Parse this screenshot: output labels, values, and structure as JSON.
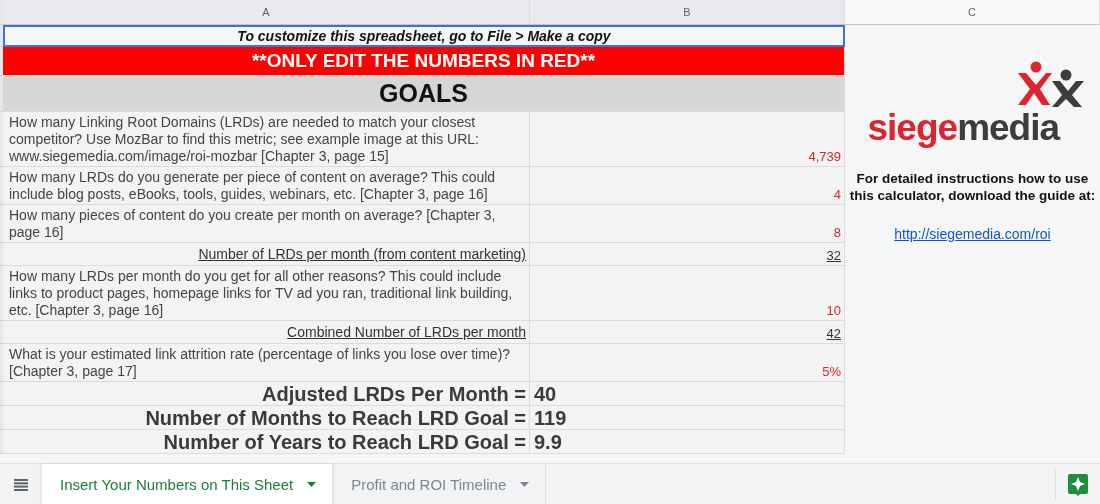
{
  "columns": [
    {
      "label": "A",
      "selected": true
    },
    {
      "label": "B",
      "selected": true
    },
    {
      "label": "C",
      "selected": false
    }
  ],
  "banner": {
    "text": "To customize this spreadsheet, go to File > Make a copy",
    "selected": true
  },
  "warning": "**ONLY EDIT THE NUMBERS IN RED**",
  "heading": "GOALS",
  "rows": [
    {
      "kind": "input",
      "label": "How many Linking Root Domains (LRDs) are needed to match your closest competitor? Use MozBar to find this metric; see example image at this URL: www.siegemedia.com/image/roi-mozbar [Chapter 3, page 15]",
      "value": "4,739"
    },
    {
      "kind": "input",
      "label": "How many LRDs do you generate per piece of content on average? This could include blog posts, eBooks, tools, guides, webinars, etc. [Chapter 3, page 16]",
      "value": "4"
    },
    {
      "kind": "input",
      "label": "How many pieces of content do you create per month on average? [Chapter 3, page 16]",
      "value": "8"
    },
    {
      "kind": "subtotal",
      "label": "Number of LRDs per month (from content marketing)",
      "value": "32"
    },
    {
      "kind": "input",
      "label": "How many LRDs per month do you get for all other reasons? This could include links to product pages, homepage links for TV ad you ran, traditional link building, etc. [Chapter 3, page 16]",
      "value": "10"
    },
    {
      "kind": "subtotal",
      "label": "Combined Number of LRDs per month",
      "value": "42"
    },
    {
      "kind": "input",
      "label": "What is your estimated link attrition rate (percentage of links you lose over time)? [Chapter 3, page 17]",
      "value": "5%"
    },
    {
      "kind": "result",
      "label": "Adjusted LRDs Per Month =",
      "value": "40"
    },
    {
      "kind": "result",
      "label": "Number of Months to Reach LRD Goal =",
      "value": "119"
    },
    {
      "kind": "result",
      "label": "Number of Years to Reach LRD Goal =",
      "value": "9.9"
    }
  ],
  "side_panel": {
    "logo": {
      "part_1": "siege",
      "part_2": "media"
    },
    "instructions": "For detailed instructions how to use this calculator, download the guide at:",
    "link": "http://siegemedia.com/roi"
  },
  "sheet_tabs": [
    {
      "label": "Insert Your Numbers on This Sheet",
      "selected": true
    },
    {
      "label": "Profit and ROI Timeline",
      "selected": false
    }
  ]
}
